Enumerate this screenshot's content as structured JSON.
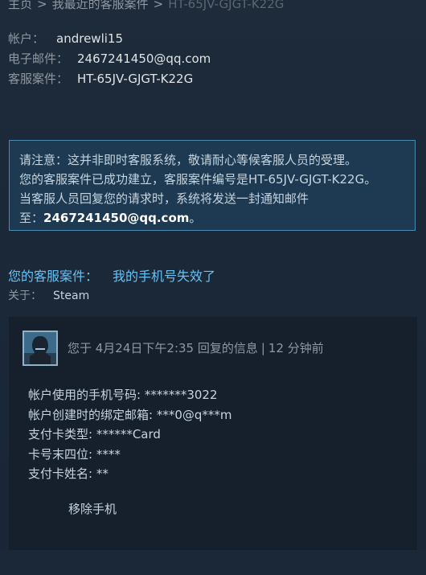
{
  "breadcrumb": {
    "home": "主页",
    "recent_cases": "我最近的客服案件",
    "current": "HT-65JV-GJGT-K22G",
    "separator": ">"
  },
  "account_info": {
    "account_label": "帐户：",
    "account_value": "andrewli15",
    "email_label": "电子邮件：",
    "email_value": "2467241450@qq.com",
    "case_label": "客服案件：",
    "case_value": "HT-65JV-GJGT-K22G"
  },
  "notice": {
    "line1": "请注意：这并非即时客服系统，敬请耐心等候客服人员的受理。",
    "line2": "您的客服案件已成功建立，客服案件编号是HT-65JV-GJGT-K22G。",
    "line3": "当客服人员回复您的请求时，系统将发送一封通知邮件",
    "line4_prefix": "至：",
    "line4_email": "2467241450@qq.com",
    "line4_suffix": "。"
  },
  "case": {
    "title_label": "您的客服案件：",
    "title_value": "我的手机号失效了",
    "about_label": "关于：",
    "about_value": "Steam"
  },
  "message": {
    "header_prefix": "您于 4月24日下午2:35 回复的信息",
    "header_sep": "|",
    "header_ago": "12 分钟前",
    "lines": [
      "帐户使用的手机号码: *******3022",
      "帐户创建时的绑定邮箱: ***0@q***m",
      "支付卡类型: ******Card",
      "卡号末四位: ****",
      "支付卡姓名: **"
    ],
    "remove_phone": "移除手机"
  },
  "colors": {
    "background": "#1b2838",
    "link_blue": "#67c1f5",
    "notice_border": "#4a8ab0",
    "notice_bg": "#1d3a52",
    "message_bg": "#16202d"
  }
}
